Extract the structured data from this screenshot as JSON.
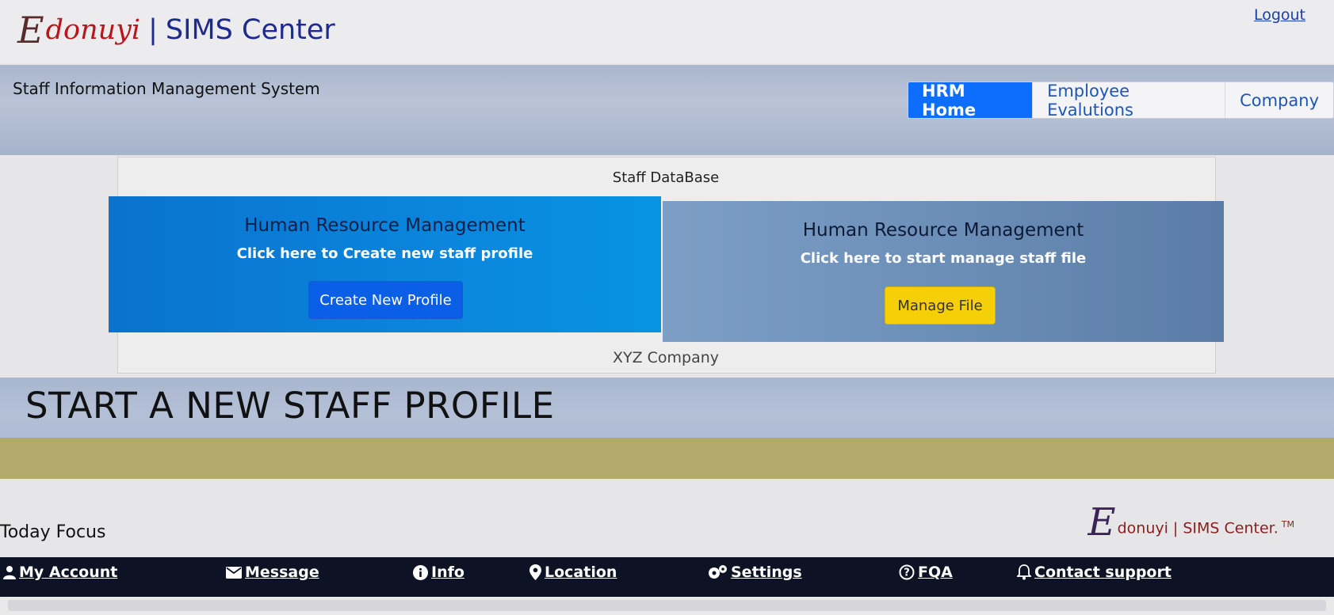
{
  "brand": {
    "script_letter": "E",
    "name": "donuyi",
    "separator": "|",
    "product": "SIMS Center"
  },
  "top_links": {
    "logout": "Logout"
  },
  "header": {
    "system_title": "Staff Information Management System",
    "nav_tabs": [
      {
        "label": "HRM Home",
        "active": true
      },
      {
        "label": "Employee Evalutions",
        "active": false
      },
      {
        "label": "Company",
        "active": false
      }
    ]
  },
  "card": {
    "header": "Staff DataBase",
    "footer": "XYZ Company",
    "left_panel": {
      "title": "Human Resource Management",
      "subtitle": "Click here to Create new staff profile",
      "button_label": "Create New Profile"
    },
    "right_panel": {
      "title": "Human Resource Management",
      "subtitle": "Click here to start manage staff file",
      "button_label": "Manage File"
    }
  },
  "headline": "START A NEW STAFF PROFILE",
  "today_focus": "Today Focus",
  "footer_brand": {
    "script_letter": "E",
    "text": "donuyi | SIMS Center.",
    "tm": "TM"
  },
  "footer_nav": [
    {
      "label": "My Account",
      "icon": "user-icon"
    },
    {
      "label": "Message",
      "icon": "envelope-icon"
    },
    {
      "label": "Info",
      "icon": "info-icon"
    },
    {
      "label": "Location",
      "icon": "map-pin-icon"
    },
    {
      "label": "Settings",
      "icon": "gears-icon"
    },
    {
      "label": "FQA",
      "icon": "question-circle-icon"
    },
    {
      "label": "Contact support",
      "icon": "bell-icon"
    }
  ],
  "colors": {
    "primary_blue": "#0d6efd",
    "manage_yellow": "#f5cf08",
    "footer_dark": "#0d1324",
    "olive_band": "#b1aa6a"
  }
}
